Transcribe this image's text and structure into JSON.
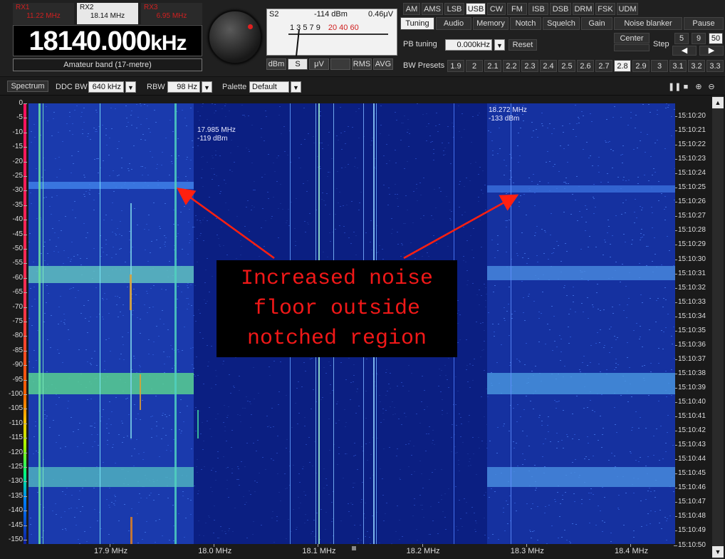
{
  "rx_tabs": [
    {
      "name": "RX1",
      "freq": "11.22 MHz"
    },
    {
      "name": "RX2",
      "freq": "18.14 MHz"
    },
    {
      "name": "RX3",
      "freq": "6.95 MHz"
    }
  ],
  "frequency": {
    "value": "18140.000",
    "unit": "kHz"
  },
  "band": "Amateur band (17-metre)",
  "smeter": {
    "s_label": "S2",
    "dbm": "-114 dBm",
    "uv": "0.46μV",
    "scale_black": "1 3 5 7 9",
    "scale_red": "20  40  60",
    "buttons": [
      "dBm",
      "S",
      "μV",
      "",
      "RMS",
      "AVG"
    ],
    "active_button": "S"
  },
  "modes": [
    "AM",
    "AMS",
    "LSB",
    "USB",
    "CW",
    "FM",
    "ISB",
    "DSB",
    "DRM",
    "FSK",
    "UDM"
  ],
  "active_mode": "USB",
  "functions": [
    "Tuning",
    "Audio",
    "Memory",
    "Notch",
    "Squelch",
    "Gain",
    "Noise blanker",
    "Pause"
  ],
  "active_function": "Tuning",
  "pb_tuning": {
    "label": "PB tuning",
    "value": "0.000kHz",
    "reset": "Reset"
  },
  "center": "Center",
  "step": {
    "label": "Step",
    "options": [
      "5",
      "9",
      "50"
    ],
    "active": "50",
    "left": "◀",
    "right": "▶"
  },
  "bw_presets": {
    "label": "BW Presets",
    "values": [
      "1.9",
      "2",
      "2.1",
      "2.2",
      "2.3",
      "2.4",
      "2.5",
      "2.6",
      "2.7",
      "2.8",
      "2.9",
      "3",
      "3.1",
      "3.2",
      "3.3"
    ],
    "active": "2.8"
  },
  "toolbar": {
    "spectrum": "Spectrum",
    "ddc_bw_label": "DDC BW",
    "ddc_bw_value": "640 kHz",
    "rbw_label": "RBW",
    "rbw_value": "98 Hz",
    "palette_label": "Palette",
    "palette_value": "Default"
  },
  "db_axis": [
    "0",
    "-5",
    "-10",
    "-15",
    "-20",
    "-25",
    "-30",
    "-35",
    "-40",
    "-45",
    "-50",
    "-55",
    "-60",
    "-65",
    "-70",
    "-75",
    "-80",
    "-85",
    "-90",
    "-95",
    "-100",
    "-105",
    "-110",
    "-115",
    "-120",
    "-125",
    "-130",
    "-135",
    "-140",
    "-145",
    "-150"
  ],
  "time_axis": [
    "15:10:20",
    "15:10:21",
    "15:10:22",
    "15:10:23",
    "15:10:24",
    "15:10:25",
    "15:10:26",
    "15:10:27",
    "15:10:28",
    "15:10:29",
    "15:10:30",
    "15:10:31",
    "15:10:32",
    "15:10:33",
    "15:10:34",
    "15:10:35",
    "15:10:36",
    "15:10:37",
    "15:10:38",
    "15:10:39",
    "15:10:40",
    "15:10:41",
    "15:10:42",
    "15:10:43",
    "15:10:44",
    "15:10:45",
    "15:10:46",
    "15:10:47",
    "15:10:48",
    "15:10:49",
    "15:10:50"
  ],
  "freq_axis": [
    "17.9 MHz",
    "18.0 MHz",
    "18.1 MHz",
    "18.2 MHz",
    "18.3 MHz",
    "18.4 MHz"
  ],
  "markers": [
    {
      "freq": "17.985 MHz",
      "level": "-119 dBm"
    },
    {
      "freq": "18.272 MHz",
      "level": "-133 dBm"
    }
  ],
  "callout": [
    "Increased noise",
    "floor outside",
    "notched region"
  ]
}
